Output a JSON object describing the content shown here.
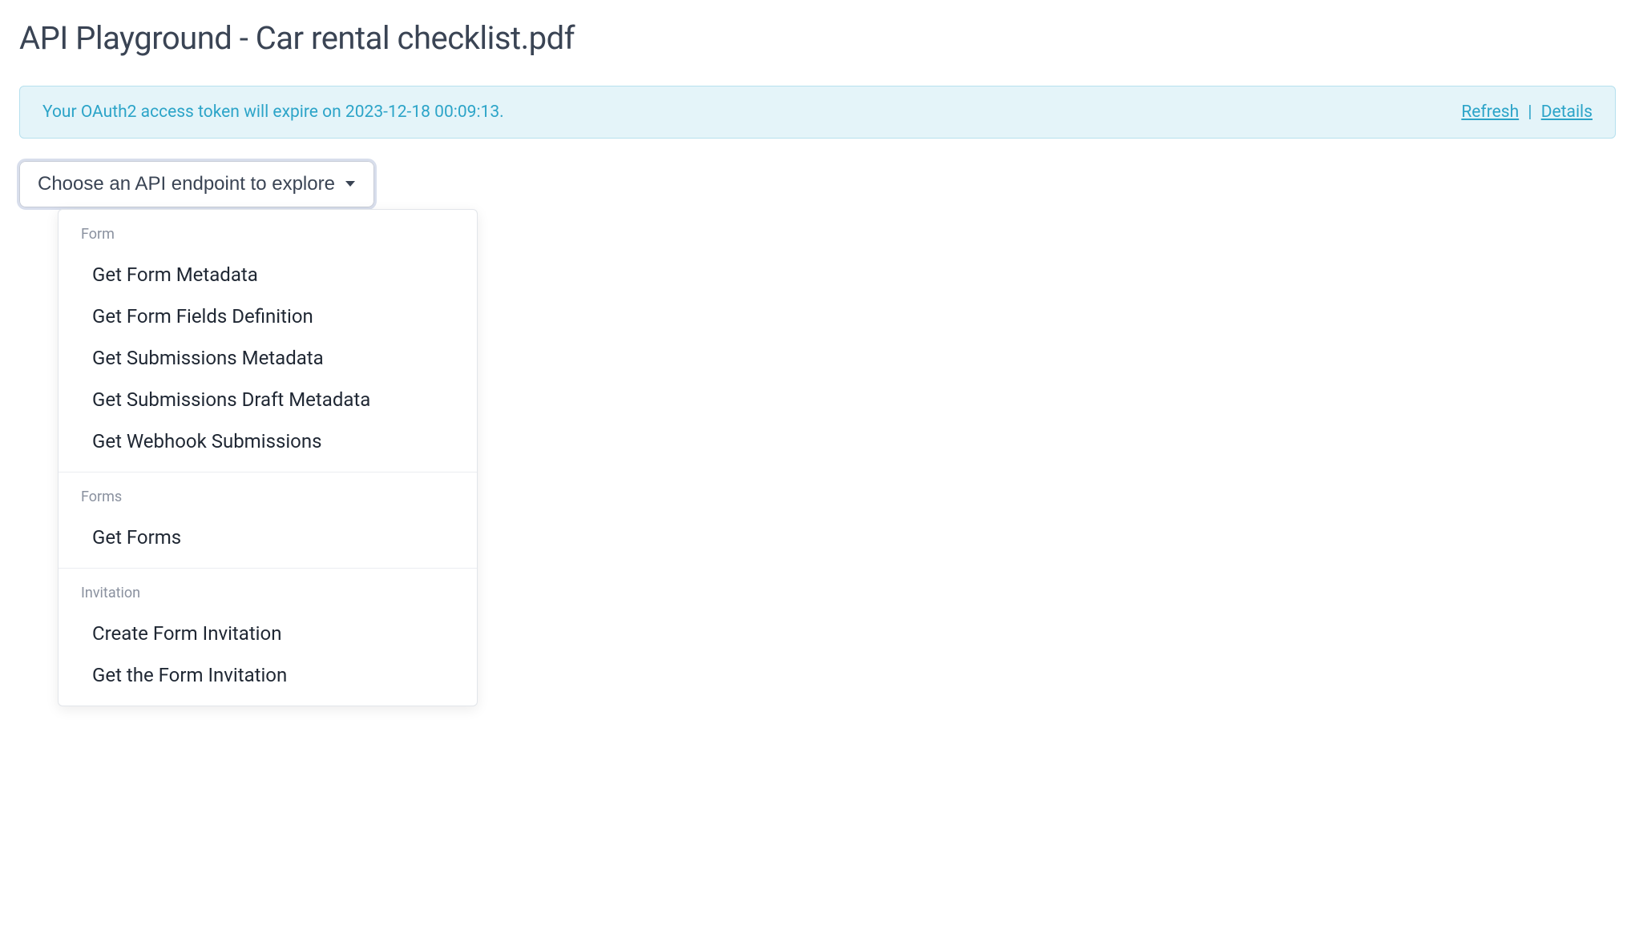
{
  "page": {
    "title": "API Playground - Car rental checklist.pdf"
  },
  "alert": {
    "message": "Your OAuth2 access token will expire on 2023-12-18 00:09:13.",
    "refresh_label": "Refresh",
    "separator": "|",
    "details_label": "Details"
  },
  "dropdown": {
    "button_label": "Choose an API endpoint to explore",
    "groups": [
      {
        "header": "Form",
        "items": [
          "Get Form Metadata",
          "Get Form Fields Definition",
          "Get Submissions Metadata",
          "Get Submissions Draft Metadata",
          "Get Webhook Submissions"
        ]
      },
      {
        "header": "Forms",
        "items": [
          "Get Forms"
        ]
      },
      {
        "header": "Invitation",
        "items": [
          "Create Form Invitation",
          "Get the Form Invitation"
        ]
      }
    ]
  }
}
